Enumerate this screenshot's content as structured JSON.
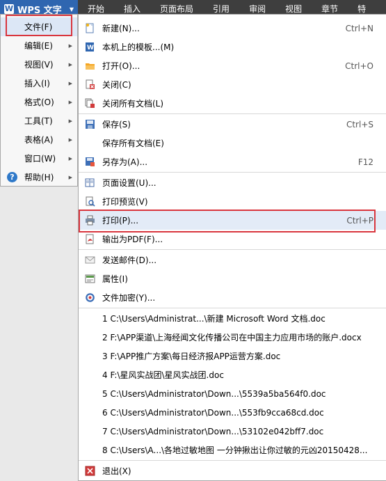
{
  "app": {
    "title": "WPS 文字",
    "logo_letter": "W"
  },
  "tabs": [
    "开始",
    "插入",
    "页面布局",
    "引用",
    "审阅",
    "视图",
    "章节",
    "特"
  ],
  "left_menu": [
    {
      "label": "文件(F)",
      "arrow": false
    },
    {
      "label": "编辑(E)",
      "arrow": true
    },
    {
      "label": "视图(V)",
      "arrow": true
    },
    {
      "label": "插入(I)",
      "arrow": true
    },
    {
      "label": "格式(O)",
      "arrow": true
    },
    {
      "label": "工具(T)",
      "arrow": true
    },
    {
      "label": "表格(A)",
      "arrow": true
    },
    {
      "label": "窗口(W)",
      "arrow": true
    },
    {
      "label": "帮助(H)",
      "arrow": true
    }
  ],
  "file_menu": {
    "group1": [
      {
        "label": "新建(N)...",
        "shortcut": "Ctrl+N",
        "icon": "new-doc-icon"
      },
      {
        "label": "本机上的模板...(M)",
        "shortcut": "",
        "icon": "template-icon"
      },
      {
        "label": "打开(O)...",
        "shortcut": "Ctrl+O",
        "icon": "open-folder-icon"
      },
      {
        "label": "关闭(C)",
        "shortcut": "",
        "icon": "close-doc-icon"
      },
      {
        "label": "关闭所有文档(L)",
        "shortcut": "",
        "icon": "close-all-icon"
      }
    ],
    "group2": [
      {
        "label": "保存(S)",
        "shortcut": "Ctrl+S",
        "icon": "save-icon"
      },
      {
        "label": "保存所有文档(E)",
        "shortcut": "",
        "icon": ""
      },
      {
        "label": "另存为(A)...",
        "shortcut": "F12",
        "icon": "save-as-icon"
      }
    ],
    "group3": [
      {
        "label": "页面设置(U)...",
        "shortcut": "",
        "icon": "page-setup-icon"
      },
      {
        "label": "打印预览(V)",
        "shortcut": "",
        "icon": "print-preview-icon"
      },
      {
        "label": "打印(P)...",
        "shortcut": "Ctrl+P",
        "icon": "printer-icon"
      },
      {
        "label": "输出为PDF(F)...",
        "shortcut": "",
        "icon": "pdf-icon"
      }
    ],
    "group4": [
      {
        "label": "发送邮件(D)...",
        "shortcut": "",
        "icon": "mail-icon"
      },
      {
        "label": "属性(I)",
        "shortcut": "",
        "icon": "properties-icon"
      },
      {
        "label": "文件加密(Y)...",
        "shortcut": "",
        "icon": "encrypt-icon"
      }
    ],
    "recent": [
      "1 C:\\Users\\Administrat...\\新建 Microsoft Word 文档.doc",
      "2 F:\\APP渠道\\上海经闻文化传播公司在中国主力应用市场的账户.docx",
      "3 F:\\APP推广方案\\每日经济报APP运营方案.doc",
      "4 F:\\星风实战团\\星风实战团.doc",
      "5 C:\\Users\\Administrator\\Down...\\5539a5ba564f0.doc",
      "6 C:\\Users\\Administrator\\Down...\\553fb9cca68cd.doc",
      "7 C:\\Users\\Administrator\\Down...\\53102e042bff7.doc",
      "8 C:\\Users\\A...\\各地过敏地图 一分钟揪出让你过敏的元凶20150428..."
    ],
    "exit": {
      "label": "退出(X)",
      "icon": "exit-icon"
    }
  }
}
